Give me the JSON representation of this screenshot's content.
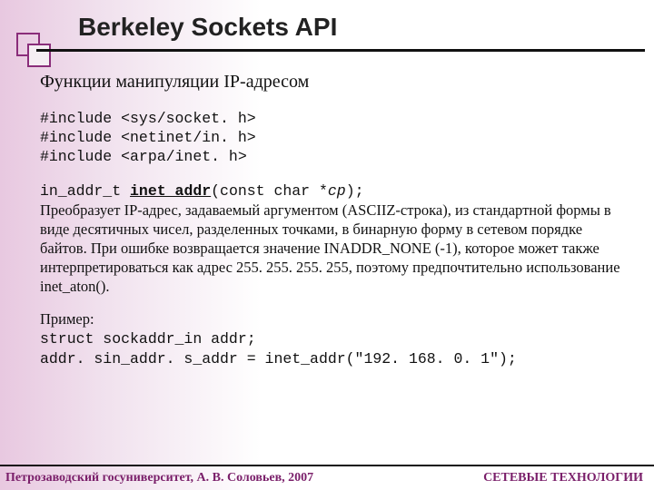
{
  "title": "Berkeley Sockets API",
  "subtitle": "Функции манипуляции IP-адресом",
  "includes": "#include <sys/socket. h>\n#include <netinet/in. h>\n#include <arpa/inet. h>",
  "sig_prefix": "in_addr_t ",
  "sig_func": "inet_addr",
  "sig_args_open": "(const char *",
  "sig_args_var": "cp",
  "sig_args_close": ");",
  "desc": "Преобразует IP-адрес, задаваемый аргументом (ASCIIZ-строка), из стандартной формы в виде десятичных чисел, разделенных точками, в бинарную форму в сетевом порядке байтов. При ошибке возвращается значение INADDR_NONE (-1), которое может также интерпретироваться как адрес 255. 255. 255. 255, поэтому предпочтительно использование inet_aton().",
  "example_label": "Пример:",
  "example_code": "struct sockaddr_in addr;\naddr. sin_addr. s_addr = inet_addr(\"192. 168. 0. 1\");",
  "footer_left": "Петрозаводский госуниверситет, А. В. Соловьев, 2007",
  "footer_right": "СЕТЕВЫЕ ТЕХНОЛОГИИ"
}
